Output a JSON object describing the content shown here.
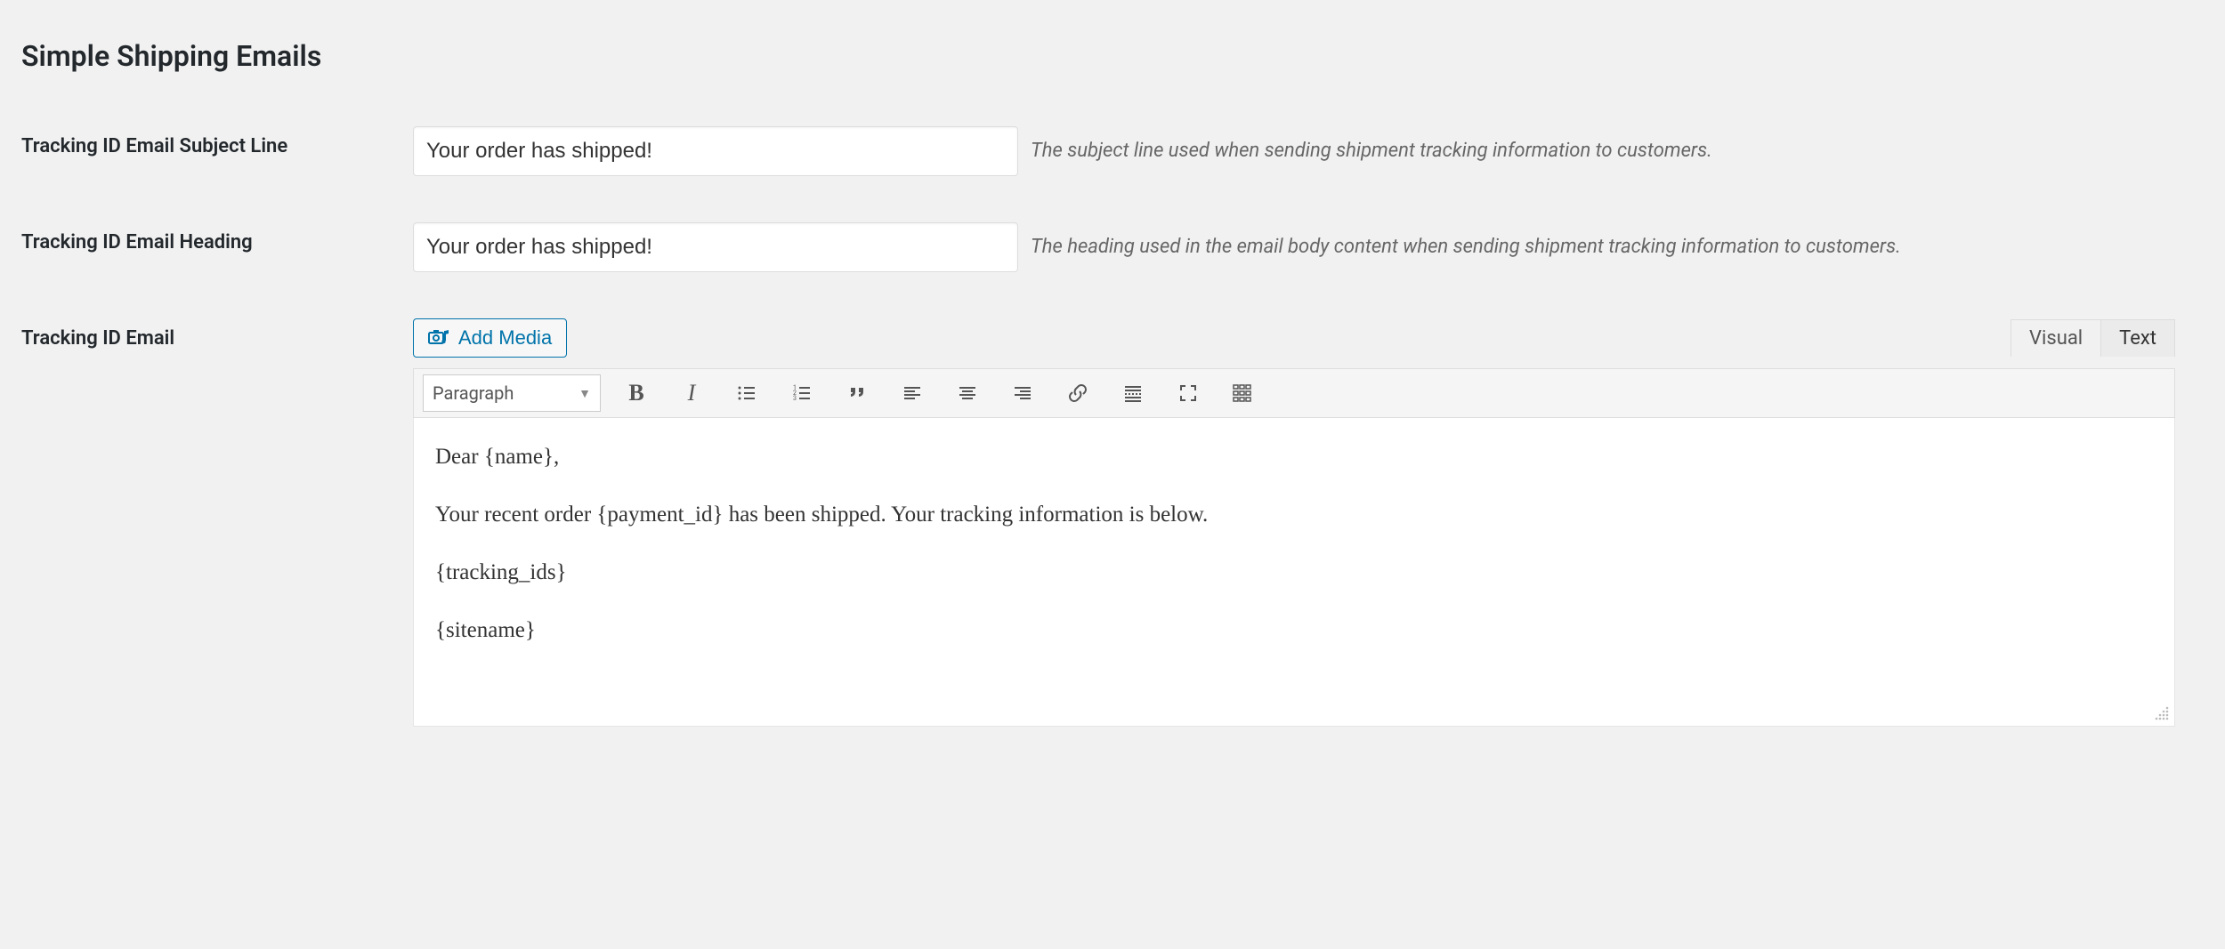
{
  "section_title": "Simple Shipping Emails",
  "fields": {
    "subject": {
      "label": "Tracking ID Email Subject Line",
      "value": "Your order has shipped!",
      "help": "The subject line used when sending shipment tracking information to customers."
    },
    "heading": {
      "label": "Tracking ID Email Heading",
      "value": "Your order has shipped!",
      "help": "The heading used in the email body content when sending shipment tracking information to customers."
    },
    "body": {
      "label": "Tracking ID Email",
      "add_media_label": "Add Media",
      "tabs": {
        "visual": "Visual",
        "text": "Text"
      },
      "format_select": "Paragraph",
      "paragraphs": [
        "Dear {name},",
        "Your recent order {payment_id} has been shipped. Your tracking information is below.",
        "{tracking_ids}",
        "{sitename}"
      ]
    }
  }
}
